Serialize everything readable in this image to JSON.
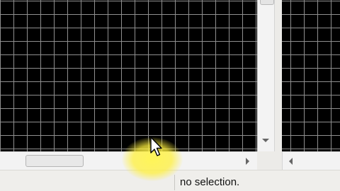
{
  "status": {
    "selection_text": "no selection."
  },
  "colors": {
    "canvas_bg": "#000000",
    "grid_line": "#8f8f8f",
    "cursor_highlight": "#fff050"
  },
  "icons": {
    "scroll_down": "arrow-down-icon",
    "scroll_right": "arrow-right-icon",
    "scroll_left": "arrow-left-icon",
    "cursor": "mouse-pointer-icon"
  }
}
